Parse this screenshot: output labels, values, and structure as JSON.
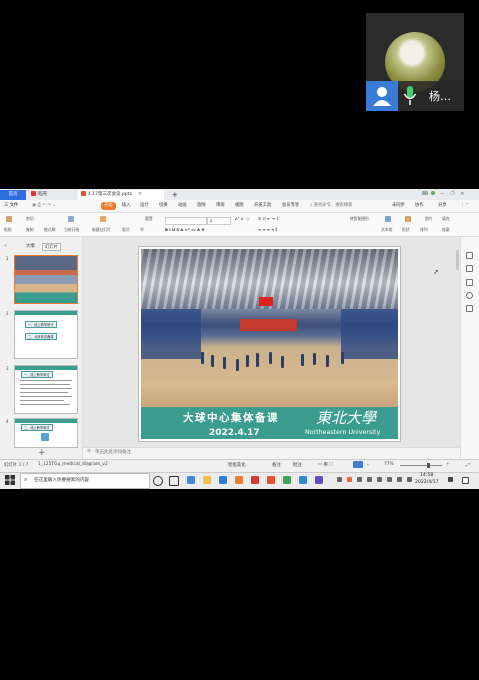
{
  "call": {
    "participant_name": "杨…",
    "icons": [
      "person-avatar-icon",
      "microphone-icon"
    ],
    "colors": {
      "avatar_bg": "#3a7bd5",
      "mic": "#3bd16f"
    }
  },
  "tabs": {
    "home": "首页",
    "daoke": "稻壳",
    "document": "4.17第三次会议.pptx",
    "new_tab": "+"
  },
  "menu": {
    "file": "三 文件",
    "start": "开始",
    "insert": "插入",
    "design": "设计",
    "transition": "切换",
    "animation": "动画",
    "slideshow": "放映",
    "review": "审阅",
    "view": "视图",
    "developer": "开发工具",
    "member": "会员专享",
    "search": "查找命令、搜索模板",
    "unsynced": "未同步",
    "collab": "协作",
    "share": "分享",
    "accent": "#ef7b2c"
  },
  "ribbon": {
    "new_slide": "新建幻灯片",
    "play_from_current": "当前开始",
    "layout": "版式",
    "section": "节",
    "reset": "重置",
    "paste": "粘贴",
    "cut": "剪切",
    "copy": "复制",
    "format_painter": "格式刷",
    "font_size": "0",
    "text_box": "文本框",
    "shape": "形状",
    "arrange": "排列",
    "picture": "图片",
    "fill": "填充",
    "outline": "轮廓",
    "convert_smartart": "转智能图形"
  },
  "left_panel": {
    "tab_outline": "大纲",
    "tab_slides": "幻灯片",
    "slide_numbers": [
      "1",
      "2",
      "3",
      "4"
    ],
    "thumb2": {
      "line1": "一、线上教学研讨",
      "line2": "二、北体年赛备课"
    },
    "thumb3": {
      "heading": "一、线上教学研讨"
    },
    "thumb4": {
      "heading": "二、线上教学研讨"
    },
    "add": "+"
  },
  "slide": {
    "caption_title": "大球中心集体备课",
    "caption_date": "2022.4.17",
    "caption_calligraphy": "東北大學",
    "caption_english": "Northeastern University",
    "caption_color": "#3a9d8f"
  },
  "notes": {
    "placeholder": "单击此处添加备注"
  },
  "status": {
    "slide_counter": "幻灯片 1 / 7",
    "file_name": "1_125TGp_medical_diagram_v2",
    "smart_beautify": "智能美化",
    "notes": "备注",
    "comments": "批注",
    "zoom": "77%"
  },
  "taskbar": {
    "search_placeholder": "在这里输入你要搜索的内容",
    "time": "14:58",
    "date": "2022/4/17"
  }
}
